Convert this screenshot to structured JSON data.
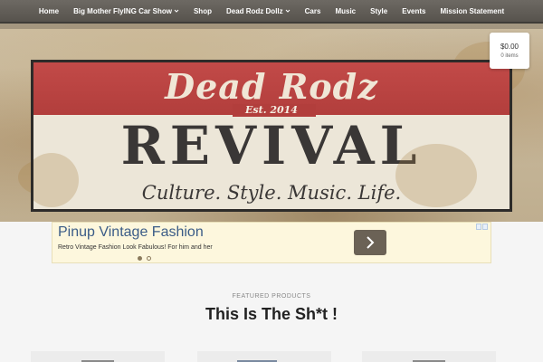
{
  "nav": {
    "items": [
      {
        "label": "Home",
        "dropdown": false
      },
      {
        "label": "Big Mother FlyING Car Show",
        "dropdown": true
      },
      {
        "label": "Shop",
        "dropdown": false
      },
      {
        "label": "Dead Rodz Dollz",
        "dropdown": true
      },
      {
        "label": "Cars",
        "dropdown": false
      },
      {
        "label": "Music",
        "dropdown": false
      },
      {
        "label": "Style",
        "dropdown": false
      },
      {
        "label": "Events",
        "dropdown": false
      },
      {
        "label": "Mission Statement",
        "dropdown": false
      }
    ]
  },
  "hero": {
    "title": "Dead Rodz",
    "established": "Est. 2014",
    "wordmark": "REVIVAL",
    "tagline": "Culture. Style. Music. Life."
  },
  "cart": {
    "total": "$0.00",
    "count": "0 items"
  },
  "ad": {
    "title": "Pinup Vintage Fashion",
    "text": "Retro Vintage Fashion Look Fabulous! For him and her",
    "slides_total": 2,
    "active_slide": 1
  },
  "featured": {
    "label": "FEATURED PRODUCTS",
    "title": "This Is The Sh*t !"
  },
  "colors": {
    "nav_bg": "#5f5b55",
    "sign_red": "#b23e3c",
    "ad_bg": "#fdf7dd",
    "ad_title": "#3b5c87"
  }
}
